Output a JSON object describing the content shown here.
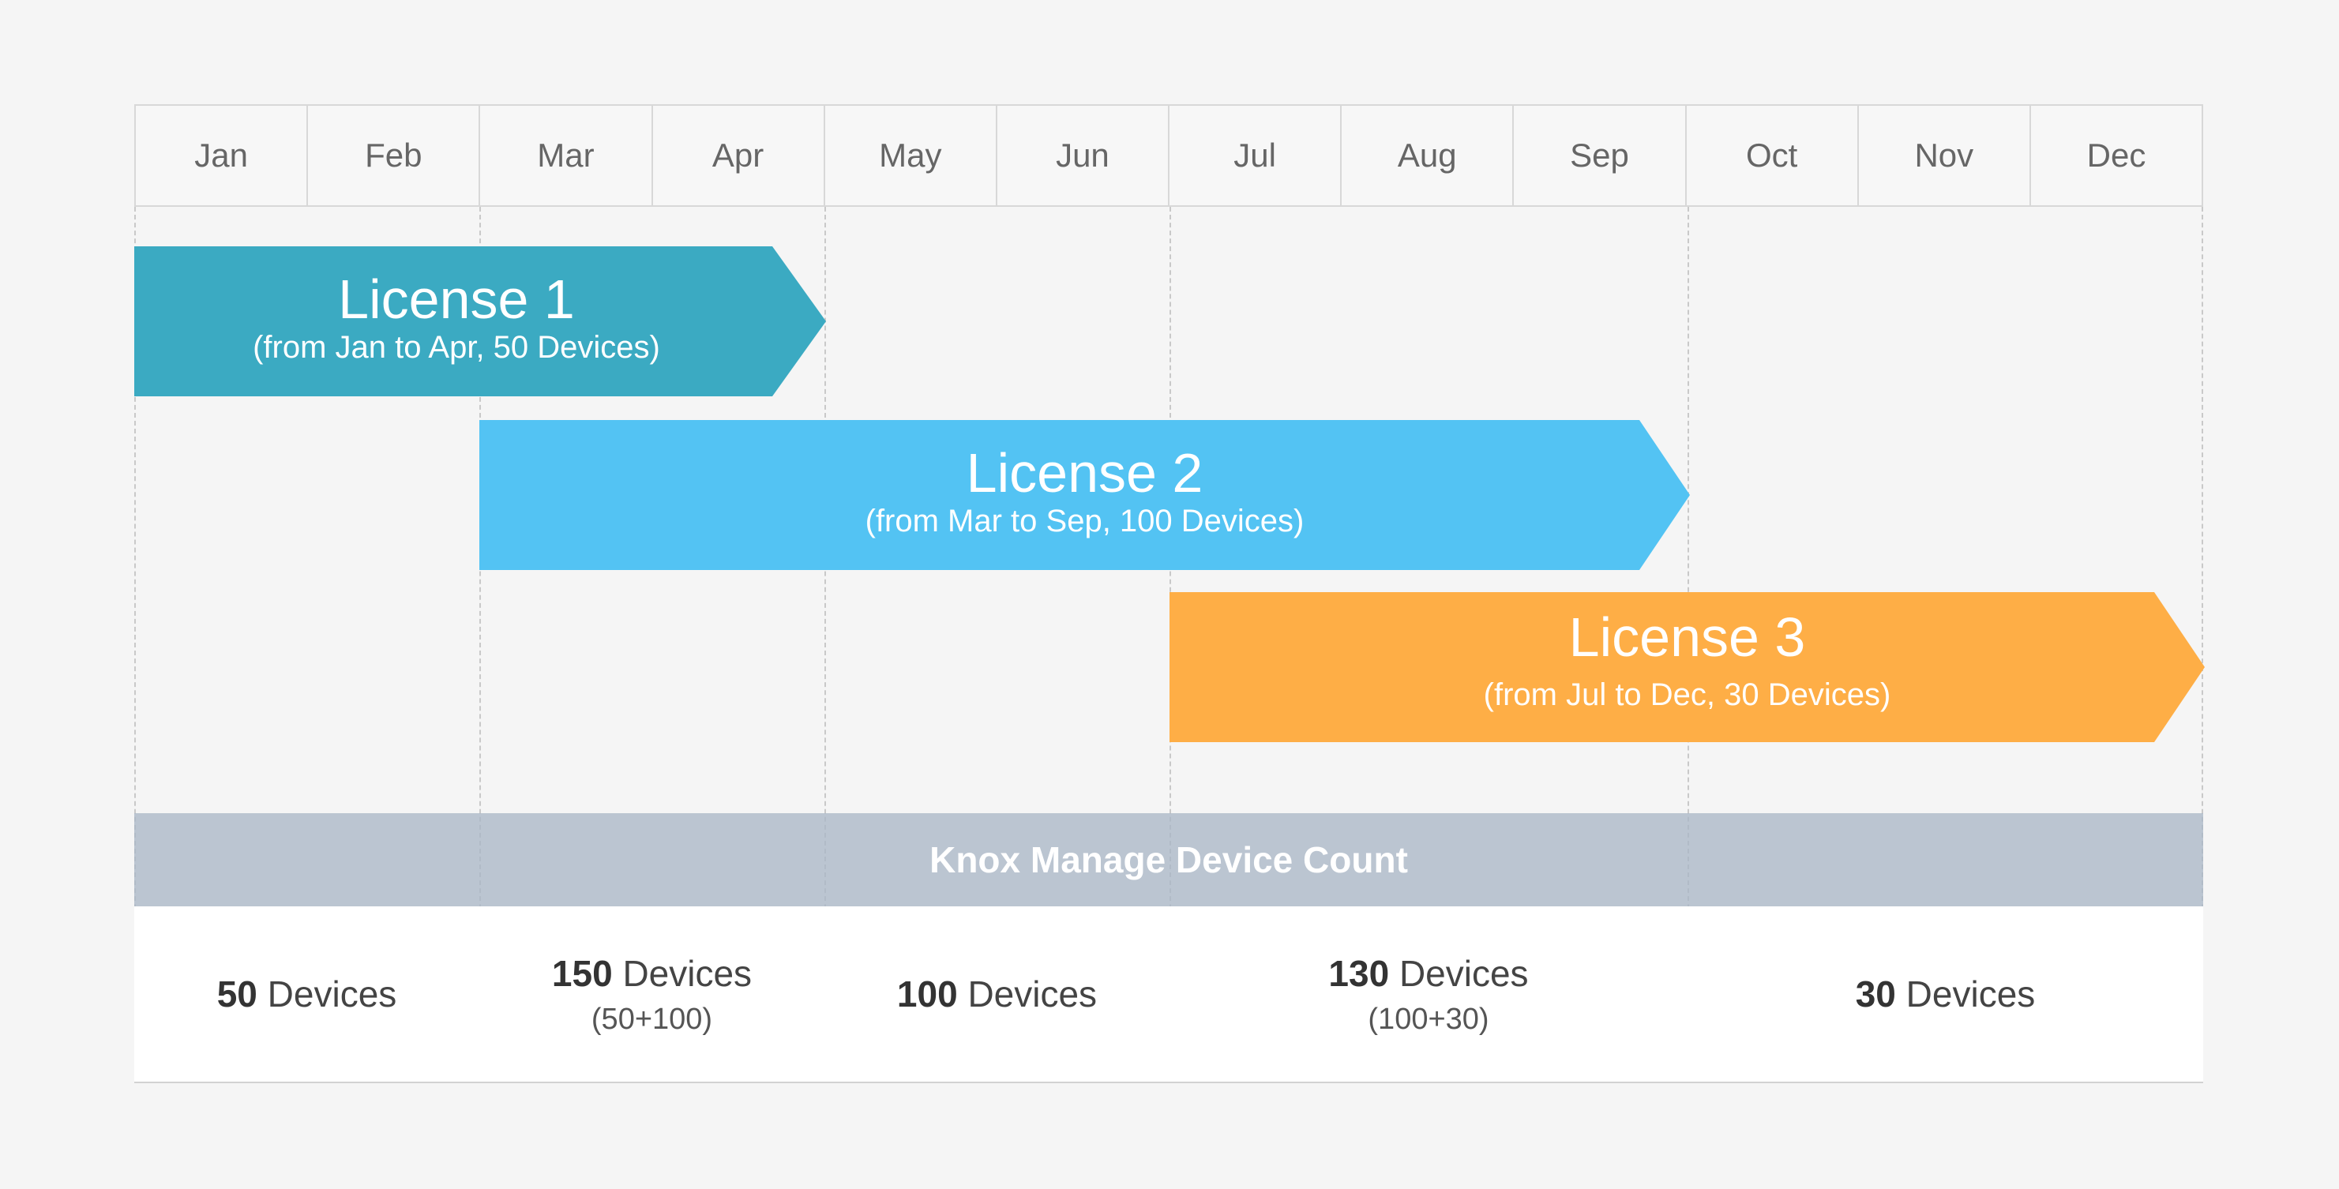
{
  "months": [
    "Jan",
    "Feb",
    "Mar",
    "Apr",
    "May",
    "Jun",
    "Jul",
    "Aug",
    "Sep",
    "Oct",
    "Nov",
    "Dec"
  ],
  "licenses": [
    {
      "name": "License 1",
      "detail": "(from Jan to Apr, 50 Devices)",
      "color": "#3baac2"
    },
    {
      "name": "License 2",
      "detail": "(from Mar to Sep, 100 Devices)",
      "color": "#53c3f3"
    },
    {
      "name": "License 3",
      "detail": "(from Jul to Dec, 30 Devices)",
      "color": "#feae46"
    }
  ],
  "summary": {
    "title": "Knox Manage Device Count",
    "segments": [
      {
        "count": "50",
        "unit": "Devices",
        "formula": ""
      },
      {
        "count": "150",
        "unit": "Devices",
        "formula": "(50+100)"
      },
      {
        "count": "100",
        "unit": "Devices",
        "formula": ""
      },
      {
        "count": "130",
        "unit": "Devices",
        "formula": "(100+30)"
      },
      {
        "count": "30",
        "unit": "Devices",
        "formula": ""
      }
    ]
  }
}
